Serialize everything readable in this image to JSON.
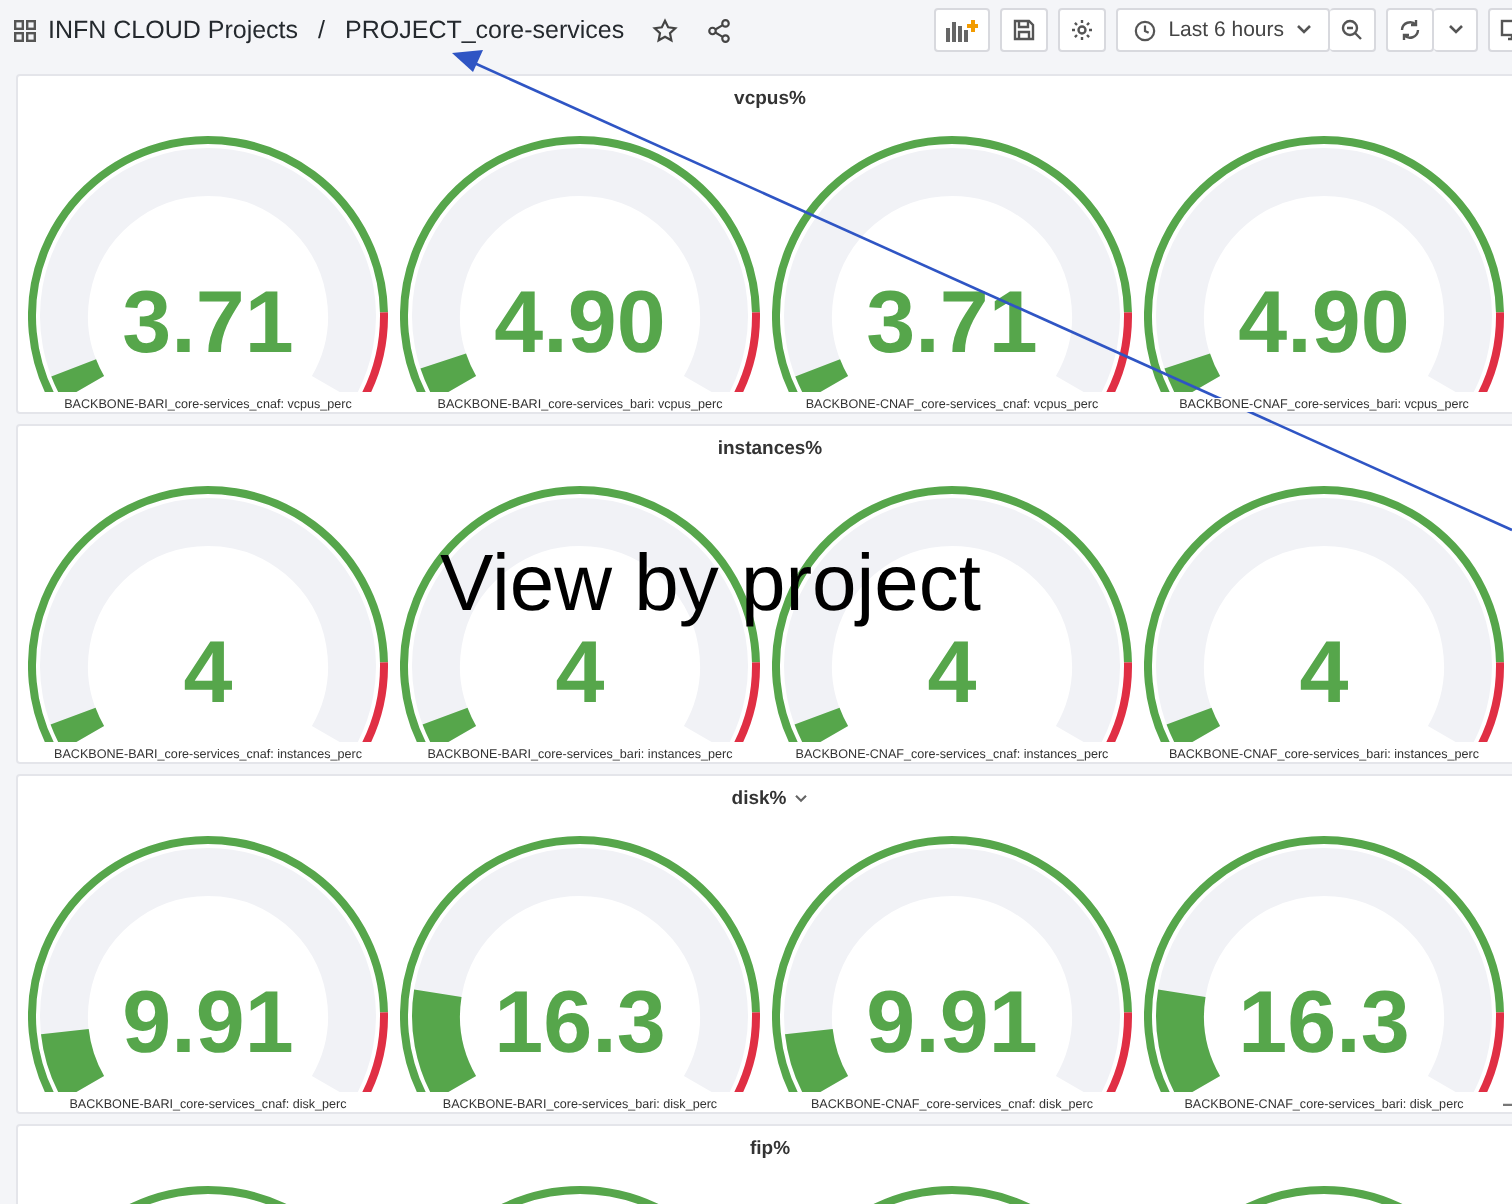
{
  "header": {
    "breadcrumb": [
      {
        "label": "INFN CLOUD Projects"
      },
      {
        "label": "PROJECT_core-services"
      }
    ],
    "separator": "/",
    "time_range": "Last 6 hours"
  },
  "panels": [
    {
      "title": "vcpus%",
      "has_menu": false,
      "resizable": false,
      "gauges": [
        {
          "kind": "gauge",
          "value": "3.71",
          "level": 0.0371,
          "label": "BACKBONE-BARI_core-services_cnaf: vcpus_perc"
        },
        {
          "kind": "gauge",
          "value": "4.90",
          "level": 0.049,
          "label": "BACKBONE-BARI_core-services_bari: vcpus_perc"
        },
        {
          "kind": "gauge",
          "value": "3.71",
          "level": 0.0371,
          "label": "BACKBONE-CNAF_core-services_cnaf: vcpus_perc"
        },
        {
          "kind": "gauge",
          "value": "4.90",
          "level": 0.049,
          "label": "BACKBONE-CNAF_core-services_bari: vcpus_perc"
        }
      ]
    },
    {
      "title": "instances%",
      "has_menu": false,
      "resizable": false,
      "gauges": [
        {
          "kind": "gauge",
          "value": "4",
          "level": 0.04,
          "label": "BACKBONE-BARI_core-services_cnaf: instances_perc"
        },
        {
          "kind": "gauge",
          "value": "4",
          "level": 0.04,
          "label": "BACKBONE-BARI_core-services_bari: instances_perc"
        },
        {
          "kind": "gauge",
          "value": "4",
          "level": 0.04,
          "label": "BACKBONE-CNAF_core-services_cnaf: instances_perc"
        },
        {
          "kind": "gauge",
          "value": "4",
          "level": 0.04,
          "label": "BACKBONE-CNAF_core-services_bari: instances_perc"
        }
      ]
    },
    {
      "title": "disk%",
      "has_menu": true,
      "resizable": true,
      "gauges": [
        {
          "kind": "gauge",
          "value": "9.91",
          "level": 0.0991,
          "label": "BACKBONE-BARI_core-services_cnaf: disk_perc"
        },
        {
          "kind": "gauge",
          "value": "16.3",
          "level": 0.163,
          "label": "BACKBONE-BARI_core-services_bari: disk_perc"
        },
        {
          "kind": "gauge",
          "value": "9.91",
          "level": 0.0991,
          "label": "BACKBONE-CNAF_core-services_cnaf: disk_perc"
        },
        {
          "kind": "gauge",
          "value": "16.3",
          "level": 0.163,
          "label": "BACKBONE-CNAF_core-services_bari: disk_perc"
        }
      ]
    },
    {
      "title": "fip%",
      "has_menu": false,
      "gauges": [
        {
          "kind": "arc-only"
        },
        {
          "kind": "arc-only"
        },
        {
          "kind": "arc-only"
        },
        {
          "kind": "arc-only"
        }
      ]
    }
  ],
  "annotation": {
    "text": "View by project"
  }
}
